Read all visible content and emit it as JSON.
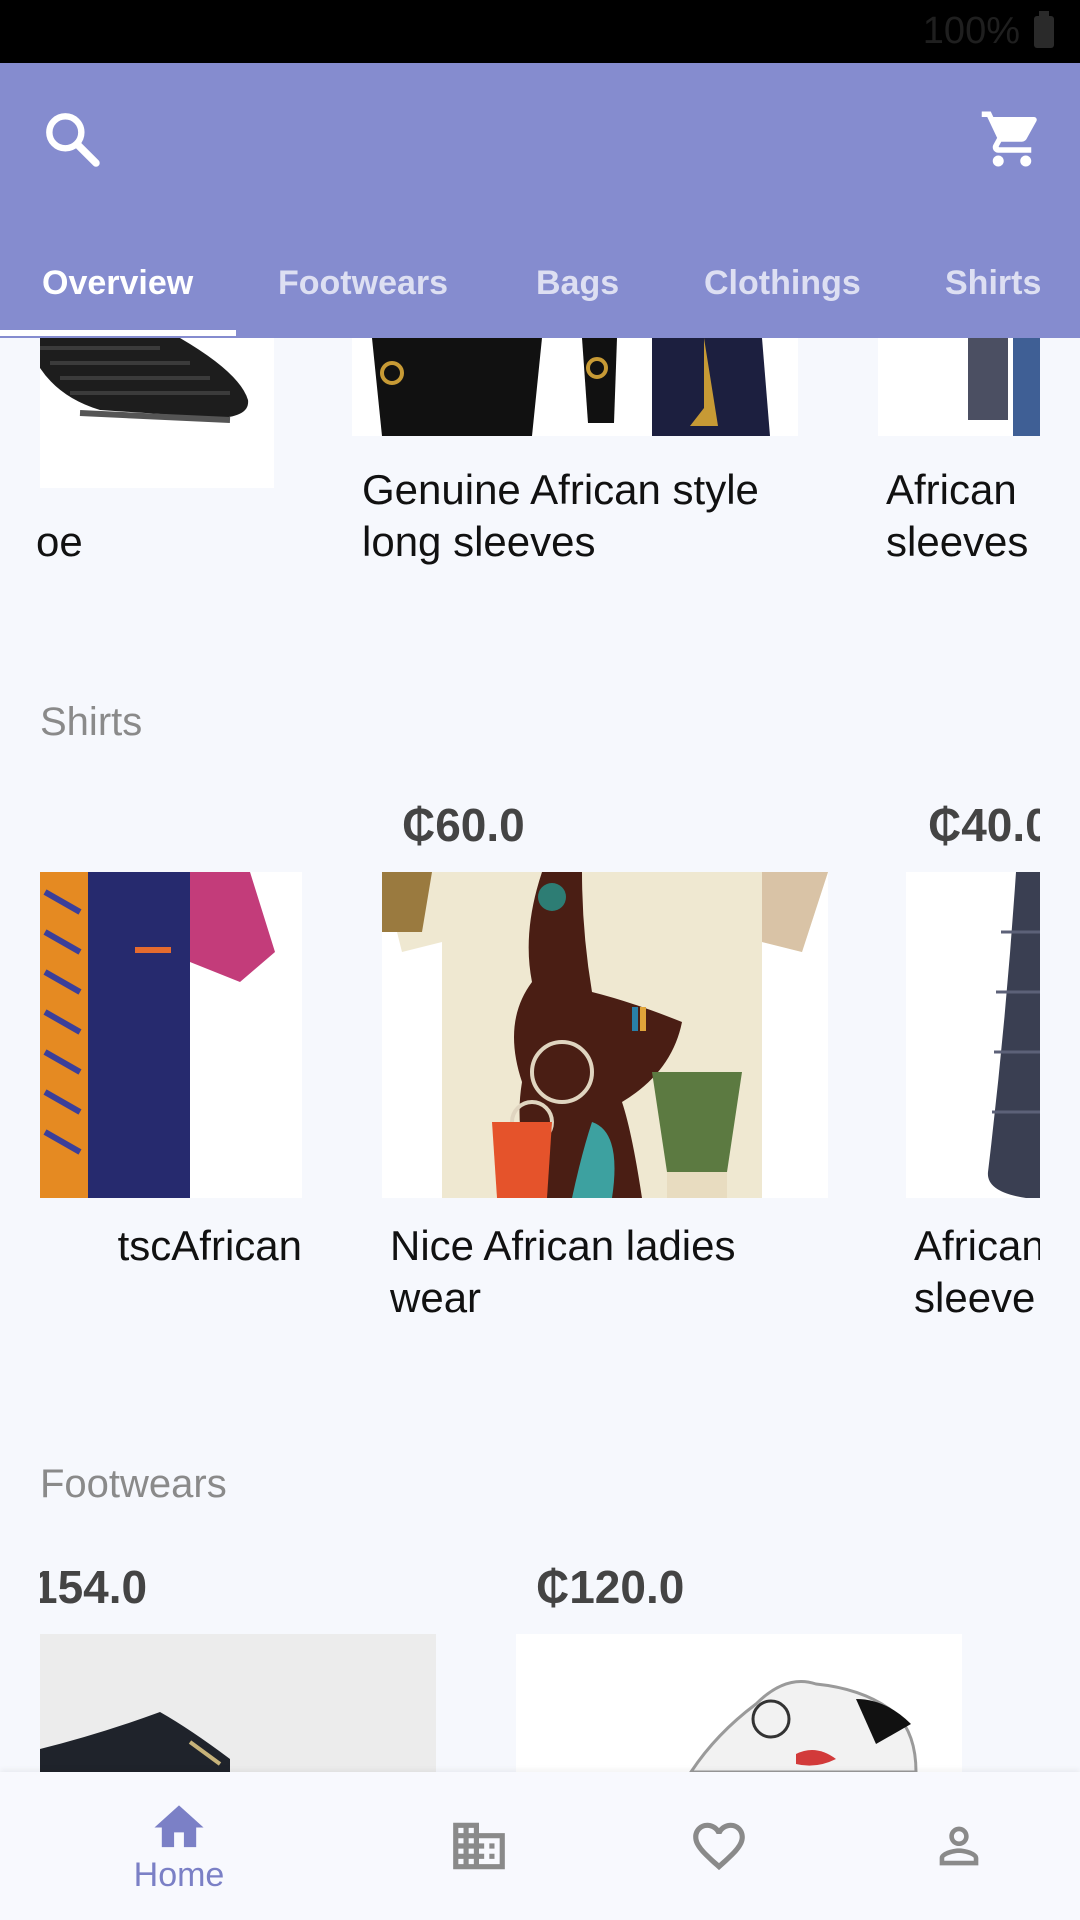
{
  "status": {
    "battery_text": "100%"
  },
  "header": {
    "tabs": [
      "Overview",
      "Footwears",
      "Bags",
      "Clothings",
      "Shirts"
    ],
    "active_tab": "Overview",
    "search_icon": "search-icon",
    "cart_icon": "cart-icon",
    "colors": {
      "appbar": "#858ccf",
      "tab_text": "#ffffff",
      "accent": "#7b80c6"
    }
  },
  "top_row": {
    "items": [
      {
        "title": "oe"
      },
      {
        "title": "Genuine African style\nlong sleeves"
      },
      {
        "title": "African\nsleeves"
      }
    ]
  },
  "shirts": {
    "title": "Shirts",
    "items": [
      {
        "price": "",
        "title": "tscAfrican"
      },
      {
        "price": "₵60.0",
        "title": "Nice African ladies\nwear"
      },
      {
        "price": "₵40.0",
        "title": "African\nsleeve"
      }
    ]
  },
  "footwears": {
    "title": "Footwears",
    "items": [
      {
        "price": "154.0"
      },
      {
        "price": "₵120.0"
      }
    ]
  },
  "bottom_nav": {
    "items": [
      {
        "label": "Home",
        "icon": "home-icon"
      },
      {
        "label": "",
        "icon": "business-icon"
      },
      {
        "label": "",
        "icon": "heart-icon"
      },
      {
        "label": "",
        "icon": "person-icon"
      }
    ]
  }
}
